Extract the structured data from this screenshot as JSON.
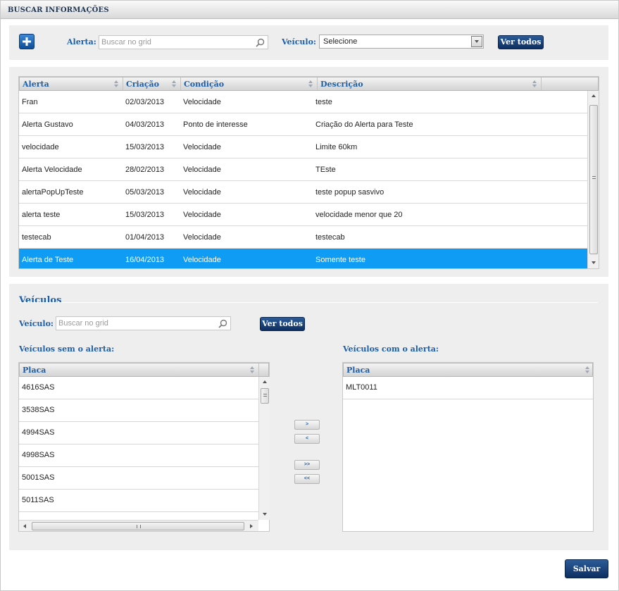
{
  "window": {
    "title": "BUSCAR INFORMAÇÕES"
  },
  "filters": {
    "alerta_label": "Alerta:",
    "alerta_placeholder": "Buscar no grid",
    "veiculo_label": "Veículo:",
    "veiculo_selected": "Selecione",
    "ver_todos_label": "Ver todos"
  },
  "alerts_grid": {
    "columns": [
      "Alerta",
      "Criação",
      "Condição",
      "Descrição"
    ],
    "rows": [
      {
        "alerta": "Fran",
        "criacao": "02/03/2013",
        "condicao": "Velocidade",
        "descricao": "teste"
      },
      {
        "alerta": "Alerta Gustavo",
        "criacao": "04/03/2013",
        "condicao": "Ponto de interesse",
        "descricao": "Criação do Alerta para Teste"
      },
      {
        "alerta": "velocidade",
        "criacao": "15/03/2013",
        "condicao": "Velocidade",
        "descricao": "Limite 60km"
      },
      {
        "alerta": "Alerta Velocidade",
        "criacao": "28/02/2013",
        "condicao": "Velocidade",
        "descricao": "TEste"
      },
      {
        "alerta": "alertaPopUpTeste",
        "criacao": "05/03/2013",
        "condicao": "Velocidade",
        "descricao": "teste popup sasvivo"
      },
      {
        "alerta": "alerta teste",
        "criacao": "15/03/2013",
        "condicao": "Velocidade",
        "descricao": "velocidade menor que 20"
      },
      {
        "alerta": "testecab",
        "criacao": "01/04/2013",
        "condicao": "Velocidade",
        "descricao": "testecab"
      },
      {
        "alerta": "Alerta de Teste",
        "criacao": "16/04/2013",
        "condicao": "Velocidade",
        "descricao": "Somente teste"
      }
    ],
    "selected_row_index": 7
  },
  "vehicles": {
    "section_title": "Veículos",
    "veiculo_label": "Veículo:",
    "search_placeholder": "Buscar no grid",
    "ver_todos_label": "Ver todos",
    "without_alert_label": "Veículos sem o alerta:",
    "with_alert_label": "Veículos com o alerta:",
    "column_header": "Placa",
    "without_alert": [
      "4616SAS",
      "3538SAS",
      "4994SAS",
      "4998SAS",
      "5001SAS",
      "5011SAS"
    ],
    "with_alert": [
      "MLT0011"
    ],
    "move_buttons": [
      ">",
      "<",
      ">>",
      "<<"
    ]
  },
  "footer": {
    "save_label": "Salvar"
  },
  "colors": {
    "accent_blue": "#1c5fa8",
    "selected_row": "#0f9cf5",
    "button_dark": "#0d2f60"
  },
  "icons": [
    "add-icon",
    "search-icon",
    "chevron-down-icon",
    "sort-icon",
    "scroll-up-icon",
    "scroll-down-icon",
    "scroll-left-icon",
    "scroll-right-icon"
  ]
}
